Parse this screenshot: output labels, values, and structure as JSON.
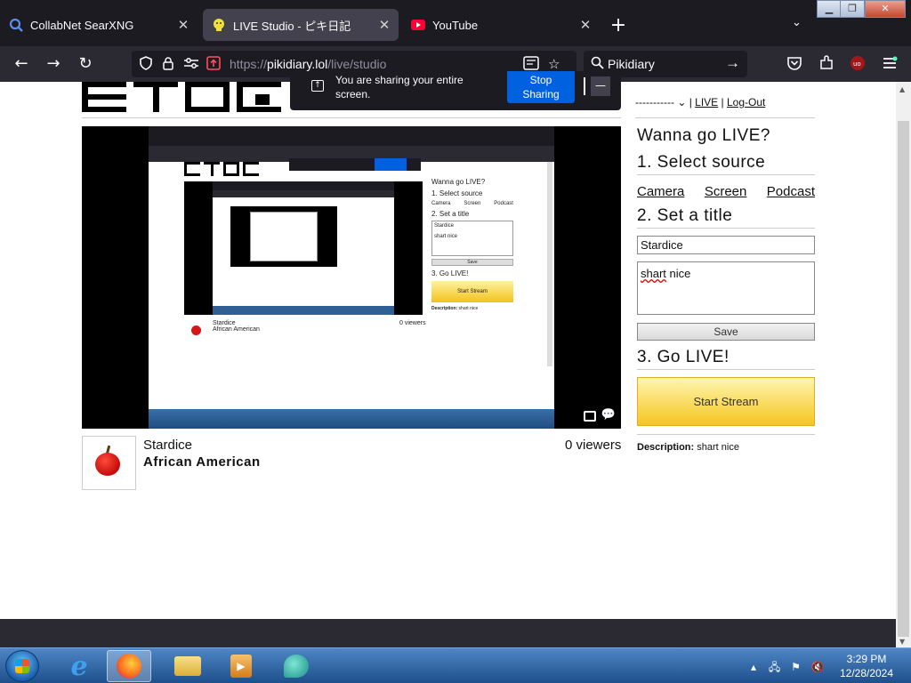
{
  "browser": {
    "tabs": [
      {
        "label": "CollabNet SearXNG",
        "icon": "search-icon"
      },
      {
        "label": "LIVE Studio - ピキ日記",
        "icon": "pikidiary-icon",
        "active": true
      },
      {
        "label": "YouTube",
        "icon": "youtube-icon"
      }
    ],
    "url": {
      "prefix": "https://",
      "host": "pikidiary.lol",
      "path": "/live/studio"
    },
    "search_text": "Pikidiary",
    "share_notice": {
      "message": "You are sharing your entire screen.",
      "stop_label_line1": "Stop",
      "stop_label_line2": "Sharing"
    }
  },
  "page": {
    "user_menu": {
      "username_masked": "-----------",
      "live_link": "LIVE",
      "logout_link": "Log-Out"
    },
    "stream_meta": {
      "channel": "Stardice",
      "title": "African American",
      "viewers": "0 viewers"
    },
    "setup": {
      "heading": "Wanna go LIVE?",
      "step1": "1. Select source",
      "sources": [
        "Camera",
        "Screen",
        "Podcast"
      ],
      "step2": "2. Set a title",
      "title_value": "Stardice",
      "description_first_word": "shart",
      "description_rest": " nice",
      "save_label": "Save",
      "step3": "3. Go LIVE!",
      "start_label": "Start Stream",
      "description_label": "Description:",
      "description_value": " shart nice"
    },
    "preview_snippet": {
      "name": "Stardice",
      "title": "African American",
      "viewers": "0 viewers"
    }
  },
  "taskbar": {
    "time": "3:29 PM",
    "date": "12/28/2024"
  },
  "colors": {
    "accent_blue": "#0061e0",
    "start_gold": "#f5c51f",
    "chrome_dark": "#1c1b22"
  }
}
